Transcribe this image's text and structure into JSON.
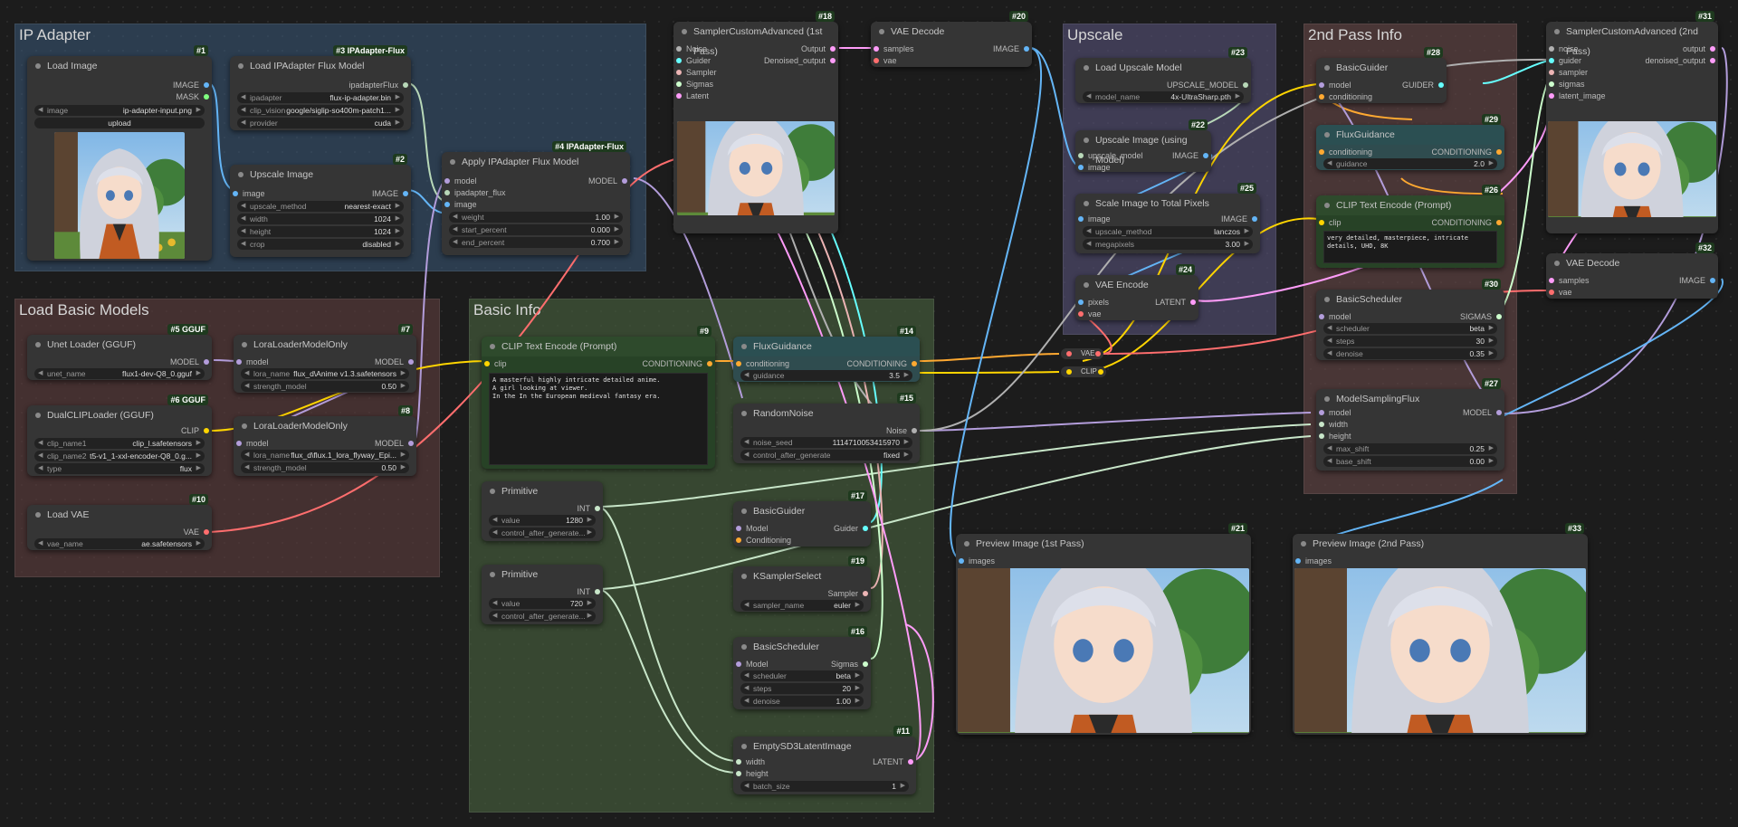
{
  "colors": {
    "image": "#64b5f6",
    "model": "#b39ddb",
    "clip": "#ffd500",
    "conditioning": "#ffa931",
    "latent": "#ff9cf9",
    "vae": "#ff6e6e",
    "int": "#c8e6c9",
    "noise": "#b0b0b0",
    "guider": "#66ffff",
    "sigmas": "#cdffcd",
    "sampler": "#ecb4b4",
    "upscale_model": "#b8d8b8"
  },
  "groups": {
    "ip": "IP Adapter",
    "basic_models": "Load Basic Models",
    "basic_info": "Basic Info",
    "upscale": "Upscale",
    "pass2": "2nd Pass Info"
  },
  "n1": {
    "title": "Load Image",
    "badge": "#1",
    "out1": "IMAGE",
    "out2": "MASK",
    "image_label": "image",
    "image_value": "ip-adapter-input.png",
    "upload": "upload"
  },
  "n3": {
    "title": "Load IPAdapter Flux Model",
    "badge": "#3 IPAdapter-Flux",
    "out": "ipadapterFlux",
    "w1l": "ipadapter",
    "w1v": "flux-ip-adapter.bin",
    "w2l": "clip_vision",
    "w2v": "google/siglip-so400m-patch1...",
    "w3l": "provider",
    "w3v": "cuda"
  },
  "n2": {
    "title": "Upscale Image",
    "badge": "#2",
    "in": "image",
    "out": "IMAGE",
    "w1l": "upscale_method",
    "w1v": "nearest-exact",
    "w2l": "width",
    "w2v": "1024",
    "w3l": "height",
    "w3v": "1024",
    "w4l": "crop",
    "w4v": "disabled"
  },
  "n4": {
    "title": "Apply IPAdapter Flux Model",
    "badge": "#4 IPAdapter-Flux",
    "in1": "model",
    "in2": "ipadapter_flux",
    "in3": "image",
    "out": "MODEL",
    "w1l": "weight",
    "w1v": "1.00",
    "w2l": "start_percent",
    "w2v": "0.000",
    "w3l": "end_percent",
    "w3v": "0.700"
  },
  "n18": {
    "title": "SamplerCustomAdvanced (1st Pass)",
    "badge": "#18",
    "in1": "Noise",
    "in2": "Guider",
    "in3": "Sampler",
    "in4": "Sigmas",
    "in5": "Latent",
    "out1": "Output",
    "out2": "Denoised_output"
  },
  "n20": {
    "title": "VAE Decode",
    "badge": "#20",
    "in1": "samples",
    "in2": "vae",
    "out": "IMAGE"
  },
  "n23": {
    "title": "Load Upscale Model",
    "badge": "#23",
    "out": "UPSCALE_MODEL",
    "w1l": "model_name",
    "w1v": "4x-UltraSharp.pth"
  },
  "n22": {
    "title": "Upscale Image (using Model)",
    "badge": "#22",
    "in1": "upscale_model",
    "in2": "image",
    "out": "IMAGE"
  },
  "n25": {
    "title": "Scale Image to Total Pixels",
    "badge": "#25",
    "in": "image",
    "out": "IMAGE",
    "w1l": "upscale_method",
    "w1v": "lanczos",
    "w2l": "megapixels",
    "w2v": "3.00"
  },
  "n24": {
    "title": "VAE Encode",
    "badge": "#24",
    "in1": "pixels",
    "in2": "vae",
    "out": "LATENT"
  },
  "reroute": {
    "vae": "VAE",
    "clip": "CLIP"
  },
  "n28": {
    "title": "BasicGuider",
    "badge": "#28",
    "in1": "model",
    "in2": "conditioning",
    "out": "GUIDER"
  },
  "n29": {
    "title": "FluxGuidance",
    "badge": "#29",
    "in": "conditioning",
    "out": "CONDITIONING",
    "w1l": "guidance",
    "w1v": "2.0"
  },
  "n26": {
    "title": "CLIP Text Encode (Prompt)",
    "badge": "#26",
    "in": "clip",
    "out": "CONDITIONING",
    "text": "very detailed, masterpiece, intricate details, UHD, 8K"
  },
  "n30": {
    "title": "BasicScheduler",
    "badge": "#30",
    "in": "model",
    "out": "SIGMAS",
    "w1l": "scheduler",
    "w1v": "beta",
    "w2l": "steps",
    "w2v": "30",
    "w3l": "denoise",
    "w3v": "0.35"
  },
  "n27": {
    "title": "ModelSamplingFlux",
    "badge": "#27",
    "in1": "model",
    "in2": "width",
    "in3": "height",
    "out": "MODEL",
    "w1l": "max_shift",
    "w1v": "0.25",
    "w2l": "base_shift",
    "w2v": "0.00"
  },
  "n31": {
    "title": "SamplerCustomAdvanced (2nd Pass)",
    "badge": "#31",
    "in1": "noise",
    "in2": "guider",
    "in3": "sampler",
    "in4": "sigmas",
    "in5": "latent_image",
    "out1": "output",
    "out2": "denoised_output"
  },
  "n32": {
    "title": "VAE Decode",
    "badge": "#32",
    "in1": "samples",
    "in2": "vae",
    "out": "IMAGE"
  },
  "n5": {
    "title": "Unet Loader (GGUF)",
    "badge": "#5 GGUF",
    "out": "MODEL",
    "w1l": "unet_name",
    "w1v": "flux1-dev-Q8_0.gguf"
  },
  "n7": {
    "title": "LoraLoaderModelOnly",
    "badge": "#7",
    "in": "model",
    "out": "MODEL",
    "w1l": "lora_name",
    "w1v": "flux_d\\Anime v1.3.safetensors",
    "w2l": "strength_model",
    "w2v": "0.50"
  },
  "n6": {
    "title": "DualCLIPLoader (GGUF)",
    "badge": "#6 GGUF",
    "out": "CLIP",
    "w1l": "clip_name1",
    "w1v": "clip_l.safetensors",
    "w2l": "clip_name2",
    "w2v": "t5-v1_1-xxl-encoder-Q8_0.g...",
    "w3l": "type",
    "w3v": "flux"
  },
  "n8": {
    "title": "LoraLoaderModelOnly",
    "badge": "#8",
    "in": "model",
    "out": "MODEL",
    "w1l": "lora_name",
    "w1v": "flux_d\\flux.1_lora_flyway_Epi...",
    "w2l": "strength_model",
    "w2v": "0.50"
  },
  "n10": {
    "title": "Load VAE",
    "badge": "#10",
    "out": "VAE",
    "w1l": "vae_name",
    "w1v": "ae.safetensors"
  },
  "n9": {
    "title": "CLIP Text Encode (Prompt)",
    "badge": "#9",
    "in": "clip",
    "out": "CONDITIONING",
    "text": "A masterful highly intricate detailed anime.\nA girl looking at viewer.\nIn the In the European medieval fantasy era."
  },
  "n14": {
    "title": "FluxGuidance",
    "badge": "#14",
    "in": "conditioning",
    "out": "CONDITIONING",
    "w1l": "guidance",
    "w1v": "3.5"
  },
  "n15": {
    "title": "RandomNoise",
    "badge": "#15",
    "out": "Noise",
    "w1l": "noise_seed",
    "w1v": "1114710053415970",
    "w2l": "control_after_generate",
    "w2v": "fixed"
  },
  "p1": {
    "title": "Primitive",
    "out": "INT",
    "w1l": "value",
    "w1v": "1280",
    "w2l": "control_after_generate..."
  },
  "p2": {
    "title": "Primitive",
    "out": "INT",
    "w1l": "value",
    "w1v": "720",
    "w2l": "control_after_generate..."
  },
  "n17": {
    "title": "BasicGuider",
    "badge": "#17",
    "in1": "Model",
    "in2": "Conditioning",
    "out": "Guider"
  },
  "n19": {
    "title": "KSamplerSelect",
    "badge": "#19",
    "out": "Sampler",
    "w1l": "sampler_name",
    "w1v": "euler"
  },
  "n16": {
    "title": "BasicScheduler",
    "badge": "#16",
    "in": "Model",
    "out": "Sigmas",
    "w1l": "scheduler",
    "w1v": "beta",
    "w2l": "steps",
    "w2v": "20",
    "w3l": "denoise",
    "w3v": "1.00"
  },
  "n11": {
    "title": "EmptySD3LatentImage",
    "badge": "#11",
    "in1": "width",
    "in2": "height",
    "out": "LATENT",
    "w1l": "batch_size",
    "w1v": "1"
  },
  "n21": {
    "title": "Preview Image (1st Pass)",
    "badge": "#21",
    "in": "images"
  },
  "n33": {
    "title": "Preview Image (2nd Pass)",
    "badge": "#33",
    "in": "images"
  }
}
